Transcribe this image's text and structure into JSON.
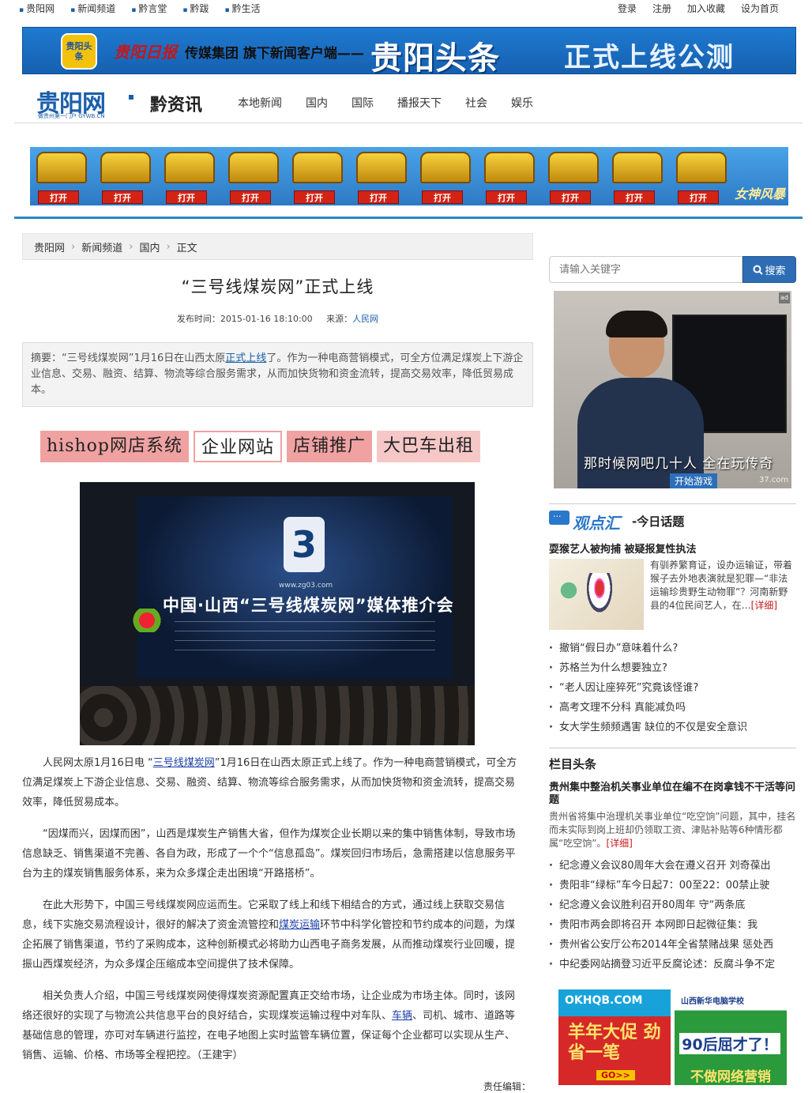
{
  "topbar": {
    "left": [
      "贵阳网",
      "新闻频道",
      "黔言堂",
      "黔跋",
      "黔生活"
    ],
    "right": [
      "登录",
      "注册",
      "加入收藏",
      "设为首页"
    ]
  },
  "top_banner": {
    "app_icon_text": "贵阳头条",
    "paper": "贵阳日报",
    "group": "传媒集团 旗下新闻客户端——",
    "headline": "贵阳头条",
    "tagline": "正式上线公测"
  },
  "nav": {
    "logo": "贵阳网",
    "logo_sub": "做贵州第一门户 GYWB.CN",
    "channel": "黔资讯",
    "links": [
      "本地新闻",
      "国内",
      "国际",
      "播报天下",
      "社会",
      "娱乐"
    ]
  },
  "game_banner": {
    "open_label": "打开",
    "game_name": "女神风暴"
  },
  "breadcrumb": [
    "贵阳网",
    "新闻频道",
    "国内",
    "正文"
  ],
  "article": {
    "title": "“三号线煤炭网”正式上线",
    "time_label": "发布时间：2015-01-16 18:10:00",
    "source_label": "来源：",
    "source": "人民网",
    "summary_a": "摘要：“三号线煤炭网”1月16日在山西太原",
    "summary_link": "正式上线",
    "summary_b": "了。作为一种电商营销模式，可全方位满足煤炭上下游企业信息、交易、融资、结算、物流等综合服务需求，从而加快货物和资金流转，提高交易效率，降低贸易成本。",
    "ads": [
      "hishop网店系统",
      "企业网站",
      "店铺推广",
      "大巴车出租"
    ],
    "photo": {
      "url": "www.zg03.com",
      "title": "中国·山西“三号线煤炭网”媒体推介会"
    },
    "p1_a": "人民网太原1月16日电 “",
    "p1_link": "三号线煤炭网",
    "p1_b": "”1月16日在山西太原正式上线了。作为一种电商营销模式，可全方位满足煤炭上下游企业信息、交易、融资、结算、物流等综合服务需求，从而加快货物和资金流转，提高交易效率，降低贸易成本。",
    "p2": "“因煤而兴，因煤而困”，山西是煤炭生产销售大省，但作为煤炭企业长期以来的集中销售体制，导致市场信息缺乏、销售渠道不完善、各自为政，形成了一个个“信息孤岛”。煤炭回归市场后，急需搭建以信息服务平台为主的煤炭销售服务体系，来为众多煤企走出困境“开路搭桥”。",
    "p3_a": "在此大形势下，中国三号线煤炭网应运而生。它采取了线上和线下相结合的方式，通过线上获取交易信息，线下实施交易流程设计，很好的解决了资金流管控和",
    "p3_link": "煤炭运输",
    "p3_b": "环节中科学化管控和节约成本的问题，为煤企拓展了销售渠道，节约了采购成本，这种创新模式必将助力山西电子商务发展，从而推动煤炭行业回暖，提振山西煤炭经济，为众多煤企压缩成本空间提供了技术保障。",
    "p4_a": "相关负责人介绍，中国三号线煤炭网使得煤炭资源配置真正交给市场，让企业成为市场主体。同时，该网络还很好的实现了与物流公共信息平台的良好结合，实现煤炭运输过程中对车队、",
    "p4_link": "车辆",
    "p4_b": "、司机、城市、道路等基础信息的管理，亦可对车辆进行监控，在电子地图上实时监管车辆位置，保证每个企业都可以实现从生产、销售、运输、价格、市场等全程把控。（王建宇）",
    "editor": "责任编辑："
  },
  "sidebar": {
    "search_placeholder": "请输入关键字",
    "search_button": "搜索",
    "video": {
      "subtitle": "那时候网吧几十人 全在玩传奇",
      "play": "开始游戏",
      "watermark": "37.com"
    },
    "opinion": {
      "logo": "观点汇",
      "title": "-今日话题",
      "headline": "耍猴艺人被拘捕 被疑报复性执法",
      "excerpt": "有驯养繁育证，设办运输证，带着猴子去外地表演就是犯罪—“非法运输珍贵野生动物罪”？河南新野县的4位民间艺人，在…",
      "more": "[详细]",
      "items": [
        "撤销“假日办”意味着什么?",
        "苏格兰为什么想要独立?",
        "“老人因让座猝死”究竟该怪谁?",
        "高考文理不分科 真能减负吗",
        "女大学生频频遇害 缺位的不仅是安全意识"
      ]
    },
    "column": {
      "title": "栏目头条",
      "headline": "贵州集中整治机关事业单位在编不在岗拿钱不干活等问题",
      "excerpt": "贵州省将集中治理机关事业单位“吃空饷”问题，其中，挂名而未实际到岗上班却仍领取工资、津贴补贴等6种情形都属“吃空饷”。",
      "more": "[详细]",
      "items": [
        "纪念遵义会议80周年大会在遵义召开 刘奇葆出",
        "贵阳非“绿标”车今日起7：00至22：00禁止驶",
        "纪念遵义会议胜利召开80周年 守“两条底",
        "贵阳市两会即将召开 本网即日起微征集：我",
        "贵州省公安厅公布2014年全省禁赌战果 惩处西",
        "中纪委网站摘登习近平反腐论述：反腐斗争不定"
      ]
    },
    "ad1": {
      "brand": "OKHQB.COM",
      "text": "羊年大促 劲省一笔",
      "go": "GO>>"
    },
    "ad2": {
      "brand": "山西新华电脑学校",
      "text": "90后屈才了！",
      "sub": "不做网络营销"
    }
  }
}
